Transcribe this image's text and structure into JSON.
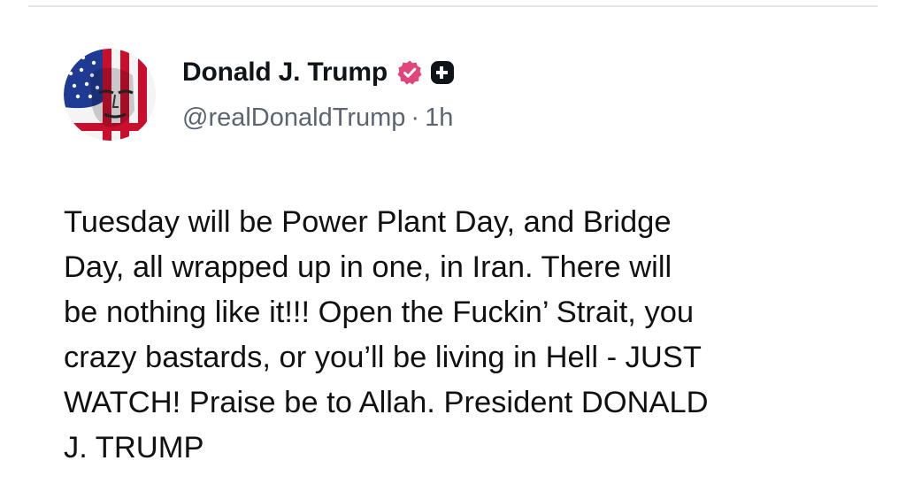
{
  "post": {
    "author": {
      "display_name": "Donald J. Trump",
      "handle": "@realDonaldTrump",
      "verified_icon": "verified-badge-icon",
      "extra_icon": "plus-badge-icon",
      "avatar_icon": "flag-face-avatar"
    },
    "separator": "·",
    "time_ago": "1h",
    "body": "Tuesday will be Power Plant Day, and Bridge\nDay, all wrapped up in one, in Iran. There will\nbe nothing like it!!! Open the Fuckin’ Strait, you\ncrazy bastards, or you’ll be living in Hell - JUST\nWATCH! Praise be to Allah. President DONALD\nJ. TRUMP"
  },
  "colors": {
    "verified_badge": "#e0457b",
    "plus_badge": "#0f1419",
    "handle_text": "#5b6470",
    "flag_red": "#c8102e",
    "flag_blue": "#1f3a93"
  }
}
